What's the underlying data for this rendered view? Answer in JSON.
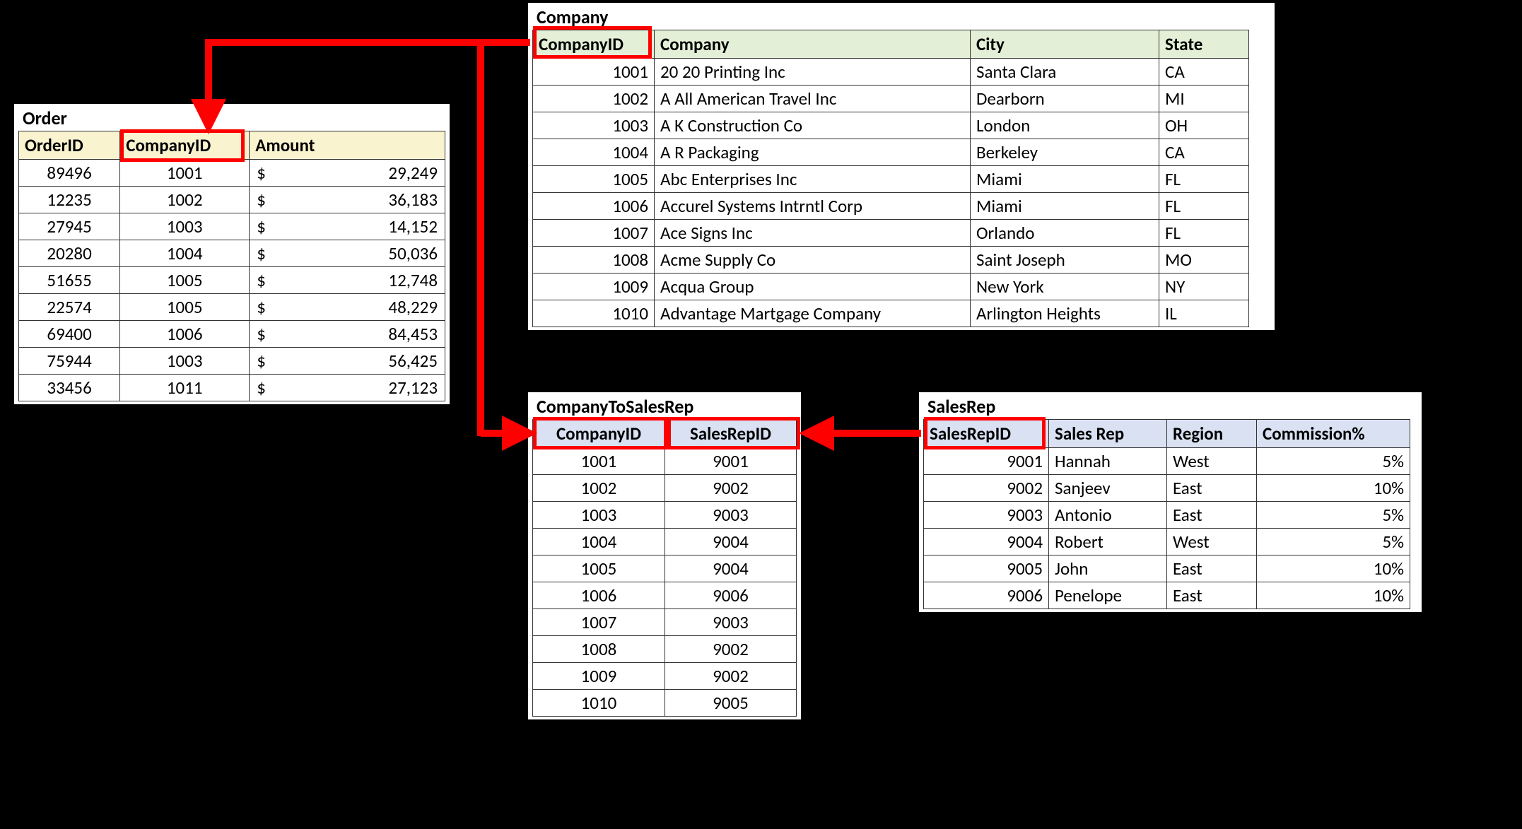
{
  "order": {
    "title": "Order",
    "headers": [
      "OrderID",
      "CompanyID",
      "Amount"
    ],
    "rows": [
      {
        "OrderID": "89496",
        "CompanyID": "1001",
        "Amount": "29,249"
      },
      {
        "OrderID": "12235",
        "CompanyID": "1002",
        "Amount": "36,183"
      },
      {
        "OrderID": "27945",
        "CompanyID": "1003",
        "Amount": "14,152"
      },
      {
        "OrderID": "20280",
        "CompanyID": "1004",
        "Amount": "50,036"
      },
      {
        "OrderID": "51655",
        "CompanyID": "1005",
        "Amount": "12,748"
      },
      {
        "OrderID": "22574",
        "CompanyID": "1005",
        "Amount": "48,229"
      },
      {
        "OrderID": "69400",
        "CompanyID": "1006",
        "Amount": "84,453"
      },
      {
        "OrderID": "75944",
        "CompanyID": "1003",
        "Amount": "56,425"
      },
      {
        "OrderID": "33456",
        "CompanyID": "1011",
        "Amount": "27,123"
      }
    ]
  },
  "company": {
    "title": "Company",
    "headers": [
      "CompanyID",
      "Company",
      "City",
      "State"
    ],
    "rows": [
      {
        "CompanyID": "1001",
        "Company": "20 20 Printing Inc",
        "City": "Santa Clara",
        "State": "CA"
      },
      {
        "CompanyID": "1002",
        "Company": "A All American Travel Inc",
        "City": "Dearborn",
        "State": "MI"
      },
      {
        "CompanyID": "1003",
        "Company": "A K Construction Co",
        "City": "London",
        "State": "OH"
      },
      {
        "CompanyID": "1004",
        "Company": "A R Packaging",
        "City": "Berkeley",
        "State": "CA"
      },
      {
        "CompanyID": "1005",
        "Company": "Abc Enterprises Inc",
        "City": "Miami",
        "State": "FL"
      },
      {
        "CompanyID": "1006",
        "Company": "Accurel Systems Intrntl Corp",
        "City": "Miami",
        "State": "FL"
      },
      {
        "CompanyID": "1007",
        "Company": "Ace Signs Inc",
        "City": "Orlando",
        "State": "FL"
      },
      {
        "CompanyID": "1008",
        "Company": "Acme Supply Co",
        "City": "Saint Joseph",
        "State": "MO"
      },
      {
        "CompanyID": "1009",
        "Company": "Acqua Group",
        "City": "New York",
        "State": "NY"
      },
      {
        "CompanyID": "1010",
        "Company": "Advantage Martgage Company",
        "City": "Arlington Heights",
        "State": "IL"
      }
    ]
  },
  "cts": {
    "title": "CompanyToSalesRep",
    "headers": [
      "CompanyID",
      "SalesRepID"
    ],
    "rows": [
      {
        "CompanyID": "1001",
        "SalesRepID": "9001"
      },
      {
        "CompanyID": "1002",
        "SalesRepID": "9002"
      },
      {
        "CompanyID": "1003",
        "SalesRepID": "9003"
      },
      {
        "CompanyID": "1004",
        "SalesRepID": "9004"
      },
      {
        "CompanyID": "1005",
        "SalesRepID": "9004"
      },
      {
        "CompanyID": "1006",
        "SalesRepID": "9006"
      },
      {
        "CompanyID": "1007",
        "SalesRepID": "9003"
      },
      {
        "CompanyID": "1008",
        "SalesRepID": "9002"
      },
      {
        "CompanyID": "1009",
        "SalesRepID": "9002"
      },
      {
        "CompanyID": "1010",
        "SalesRepID": "9005"
      }
    ]
  },
  "salesrep": {
    "title": "SalesRep",
    "headers": [
      "SalesRepID",
      "Sales Rep",
      "Region",
      "Commission%"
    ],
    "rows": [
      {
        "SalesRepID": "9001",
        "SalesRep": "Hannah",
        "Region": "West",
        "Commission": "5%"
      },
      {
        "SalesRepID": "9002",
        "SalesRep": "Sanjeev",
        "Region": "East",
        "Commission": "10%"
      },
      {
        "SalesRepID": "9003",
        "SalesRep": "Antonio",
        "Region": "East",
        "Commission": "5%"
      },
      {
        "SalesRepID": "9004",
        "SalesRep": "Robert",
        "Region": "West",
        "Commission": "5%"
      },
      {
        "SalesRepID": "9005",
        "SalesRep": "John",
        "Region": "East",
        "Commission": "10%"
      },
      {
        "SalesRepID": "9006",
        "SalesRep": "Penelope",
        "Region": "East",
        "Commission": "10%"
      }
    ]
  },
  "currency": "$"
}
